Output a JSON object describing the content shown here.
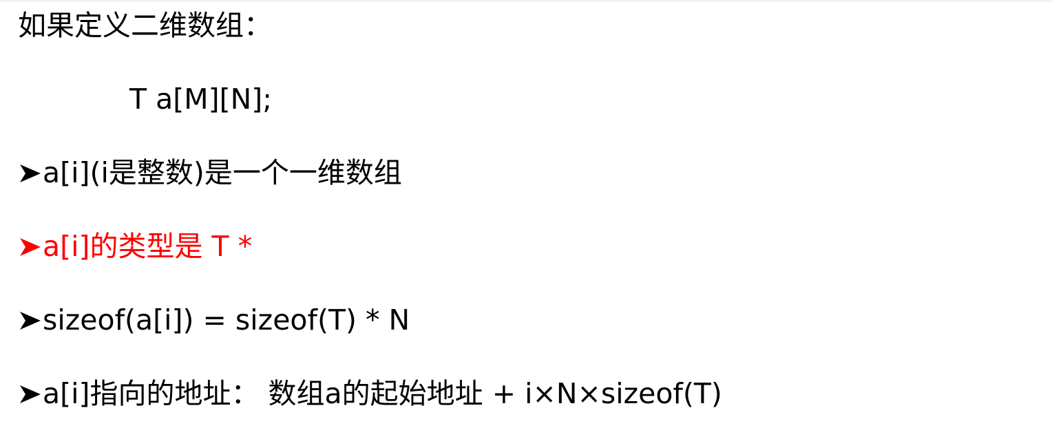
{
  "lines": {
    "intro": "如果定义二维数组：",
    "declaration": "T a[M][N];",
    "bullet1": "a[i](i是整数)是一个一维数组",
    "bullet2": "a[i]的类型是 T *",
    "bullet3": "sizeof(a[i]) = sizeof(T) * N",
    "bullet4": "a[i]指向的地址： 数组a的起始地址 + i×N×sizeof(T)"
  },
  "colors": {
    "text": "#000000",
    "highlight": "#ff0000"
  },
  "icons": {
    "bullet": "arrow-bullet-icon"
  }
}
